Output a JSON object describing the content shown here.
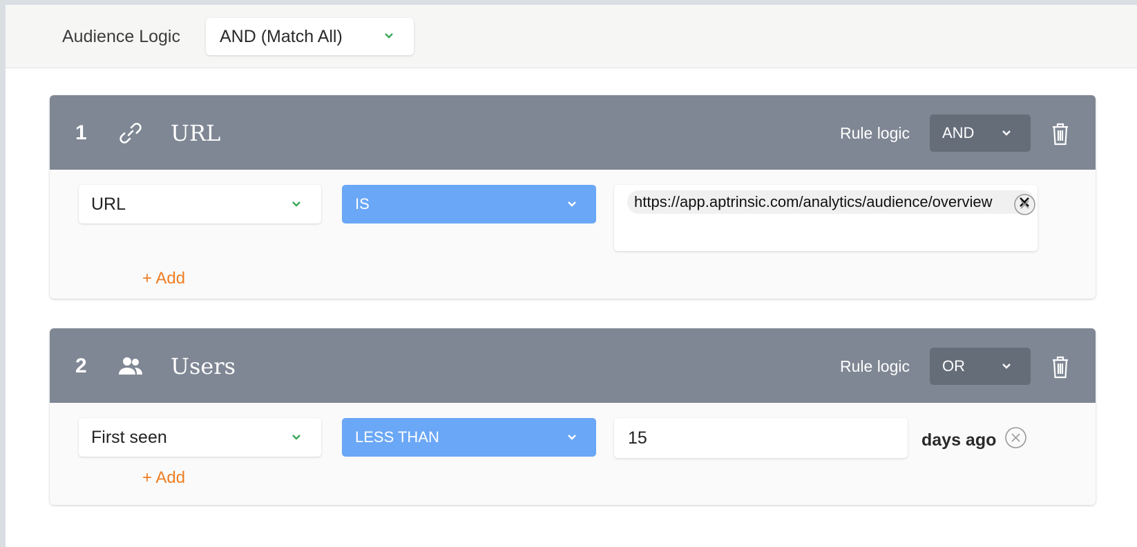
{
  "audience": {
    "label": "Audience Logic",
    "selected": "AND (Match All)"
  },
  "colors": {
    "header_bg": "#7f8794",
    "operator_bg": "#6aa7f6",
    "add_link": "#ee7d22",
    "chevron_accent": "#3aaa5a"
  },
  "rules": [
    {
      "number": "1",
      "icon": "link-icon",
      "title": "URL",
      "rule_logic_label": "Rule logic",
      "rule_logic_value": "AND",
      "field": "URL",
      "operator": "IS",
      "value_chip": "https://app.aptrinsic.com/analytics/audience/overview",
      "add_label": "+ Add"
    },
    {
      "number": "2",
      "icon": "users-icon",
      "title": "Users",
      "rule_logic_label": "Rule logic",
      "rule_logic_value": "OR",
      "field": "First seen",
      "operator": "LESS THAN",
      "value": "15",
      "suffix": "days ago",
      "add_label": "+ Add"
    }
  ]
}
